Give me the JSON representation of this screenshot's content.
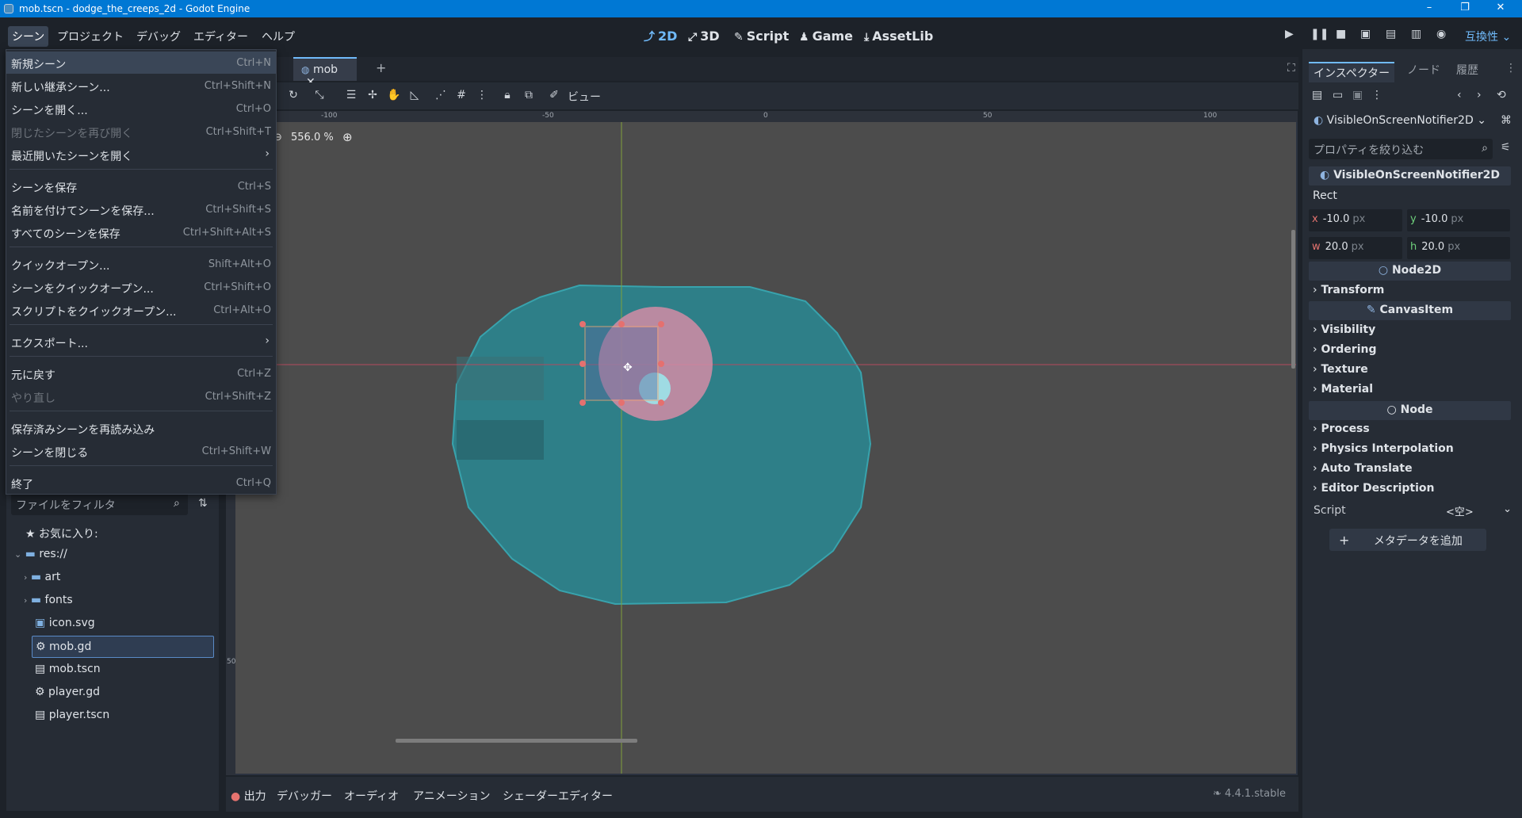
{
  "window": {
    "title": "mob.tscn - dodge_the_creeps_2d - Godot Engine",
    "minimize": "–",
    "maximize": "❐",
    "close": "✕"
  },
  "menubar": {
    "items": [
      "シーン",
      "プロジェクト",
      "デバッグ",
      "エディター",
      "ヘルプ"
    ]
  },
  "main_screens": {
    "2d": "2D",
    "3d": "3D",
    "script": "Script",
    "game": "Game",
    "assetlib": "AssetLib"
  },
  "renderer": "互換性",
  "scene_tabs": {
    "partial": "r",
    "mob": "mob",
    "close": "✕",
    "add": "+"
  },
  "toolbar": {
    "view_label": "ビュー"
  },
  "viewport": {
    "zoom": "556.0 %",
    "ruler_ticks": [
      "-100",
      "-50",
      "0",
      "50",
      "100"
    ],
    "left_ruler_tick": "50"
  },
  "scene_menu": {
    "items": [
      {
        "label": "新規シーン",
        "shortcut": "Ctrl+N"
      },
      {
        "label": "新しい継承シーン...",
        "shortcut": "Ctrl+Shift+N"
      },
      {
        "label": "シーンを開く...",
        "shortcut": "Ctrl+O"
      },
      {
        "label": "閉じたシーンを再び開く",
        "shortcut": "Ctrl+Shift+T"
      },
      {
        "label": "最近開いたシーンを開く",
        "shortcut": ""
      },
      {
        "label": "シーンを保存",
        "shortcut": "Ctrl+S"
      },
      {
        "label": "名前を付けてシーンを保存...",
        "shortcut": "Ctrl+Shift+S"
      },
      {
        "label": "すべてのシーンを保存",
        "shortcut": "Ctrl+Shift+Alt+S"
      },
      {
        "label": "クイックオープン...",
        "shortcut": "Shift+Alt+O"
      },
      {
        "label": "シーンをクイックオープン...",
        "shortcut": "Ctrl+Shift+O"
      },
      {
        "label": "スクリプトをクイックオープン...",
        "shortcut": "Ctrl+Alt+O"
      },
      {
        "label": "エクスポート...",
        "shortcut": ""
      },
      {
        "label": "元に戻す",
        "shortcut": "Ctrl+Z"
      },
      {
        "label": "やり直し",
        "shortcut": "Ctrl+Shift+Z"
      },
      {
        "label": "保存済みシーンを再読み込み",
        "shortcut": ""
      },
      {
        "label": "シーンを閉じる",
        "shortcut": "Ctrl+Shift+W"
      },
      {
        "label": "終了",
        "shortcut": "Ctrl+Q"
      }
    ]
  },
  "filesystem": {
    "filter_placeholder": "ファイルをフィルタ",
    "favorites": "お気に入り:",
    "root": "res://",
    "items": [
      "art",
      "fonts",
      "icon.svg",
      "mob.gd",
      "mob.tscn",
      "player.gd",
      "player.tscn"
    ]
  },
  "inspector": {
    "tabs": [
      "インスペクター",
      "ノード",
      "履歴"
    ],
    "node_type": "VisibleOnScreenNotifier2D",
    "filter_placeholder": "プロパティを絞り込む",
    "class_header": "VisibleOnScreenNotifier2D",
    "rect_label": "Rect",
    "rect": {
      "x": "-10.0",
      "y": "-10.0",
      "w": "20.0",
      "h": "20.0",
      "unit": "px"
    },
    "axis": {
      "x": "x",
      "y": "y",
      "w": "w",
      "h": "h"
    },
    "node2d": "Node2D",
    "transform": "Transform",
    "canvasitem": "CanvasItem",
    "visibility": "Visibility",
    "ordering": "Ordering",
    "texture": "Texture",
    "material": "Material",
    "node": "Node",
    "process": "Process",
    "physics_interp": "Physics Interpolation",
    "auto_translate": "Auto Translate",
    "editor_desc": "Editor Description",
    "script_label": "Script",
    "script_value": "<空>",
    "add_metadata": "メタデータを追加"
  },
  "bottom": {
    "tabs": [
      "出力",
      "デバッガー",
      "オーディオ",
      "アニメーション",
      "シェーダーエディター"
    ],
    "version": "4.4.1.stable"
  }
}
